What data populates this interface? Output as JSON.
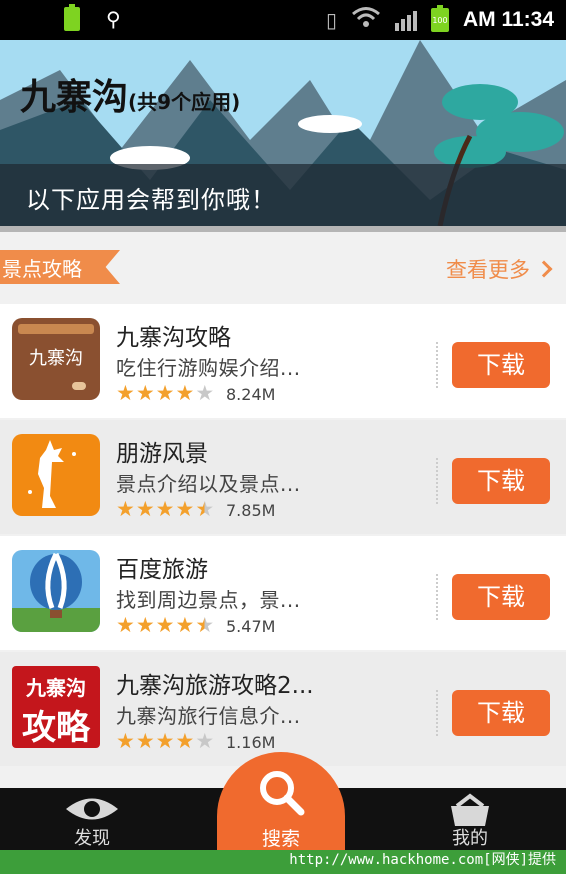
{
  "status_bar": {
    "time": "AM 11:34",
    "icons": [
      "battery-icon",
      "usb-icon",
      "vibrate-icon",
      "wifi-icon",
      "signal-icon",
      "battery-full-icon"
    ],
    "battery_label": "100"
  },
  "banner": {
    "title": "九寨沟",
    "app_count": "(共9个应用)",
    "subtitle": "以下应用会帮到你哦！"
  },
  "section": {
    "tag": "景点攻略",
    "see_more": "查看更多"
  },
  "apps": [
    {
      "name": "九寨沟攻略",
      "desc": "吃住行游购娱介绍...",
      "rating": 4,
      "size": "8.24M",
      "button": "下载",
      "icon": "jiuzhaigou-guide-icon",
      "icon_text": "九寨沟"
    },
    {
      "name": "朋游风景",
      "desc": "景点介绍以及景点...",
      "rating": 4.5,
      "size": "7.85M",
      "button": "下载",
      "icon": "giraffe-icon"
    },
    {
      "name": "百度旅游",
      "desc": "找到周边景点，景...",
      "rating": 4.5,
      "size": "5.47M",
      "button": "下载",
      "icon": "hot-air-balloon-icon"
    },
    {
      "name": "九寨沟旅游攻略2...",
      "desc": "九寨沟旅行信息介...",
      "rating": 4,
      "size": "1.16M",
      "button": "下载",
      "icon": "jiuzhaigou-strategy-icon",
      "icon_text_top": "九寨沟",
      "icon_text_bottom": "攻略"
    }
  ],
  "bottom_nav": {
    "discover": "发现",
    "search": "搜索",
    "mine": "我的"
  },
  "watermark": "http://www.hackhome.com[网侠]提供",
  "colors": {
    "accent": "#f06a2e",
    "tag": "#f08c4a",
    "star": "#f3a02c"
  }
}
